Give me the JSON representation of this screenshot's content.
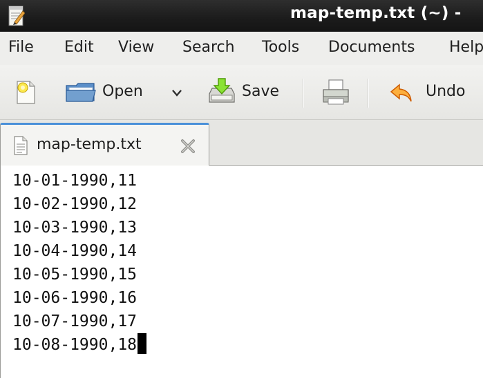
{
  "window": {
    "title": "map-temp.txt (~) -",
    "app_icon": "text-editor-icon"
  },
  "menubar": {
    "items": [
      "File",
      "Edit",
      "View",
      "Search",
      "Tools",
      "Documents",
      "Help"
    ]
  },
  "toolbar": {
    "new_icon": "new-document-icon",
    "open_label": "Open",
    "open_icon": "folder-open-icon",
    "open_dropdown_icon": "chevron-down-icon",
    "save_label": "Save",
    "save_icon": "save-icon",
    "print_icon": "printer-icon",
    "undo_label": "Undo",
    "undo_icon": "undo-icon"
  },
  "tabs": [
    {
      "label": "map-temp.txt",
      "icon": "text-file-icon",
      "close_icon": "close-icon",
      "active": true
    }
  ],
  "editor": {
    "lines": [
      "10-01-1990,11",
      "10-02-1990,12",
      "10-03-1990,13",
      "10-04-1990,14",
      "10-05-1990,15",
      "10-06-1990,16",
      "10-07-1990,17",
      "10-08-1990,18"
    ],
    "cursor_line": 8
  },
  "colors": {
    "titlebar": "#1b1b1b",
    "menubar": "#eeeeec",
    "toolbar": "#e6e6e3",
    "tab_accent": "#4a90d9",
    "editor_bg": "#ffffff"
  }
}
